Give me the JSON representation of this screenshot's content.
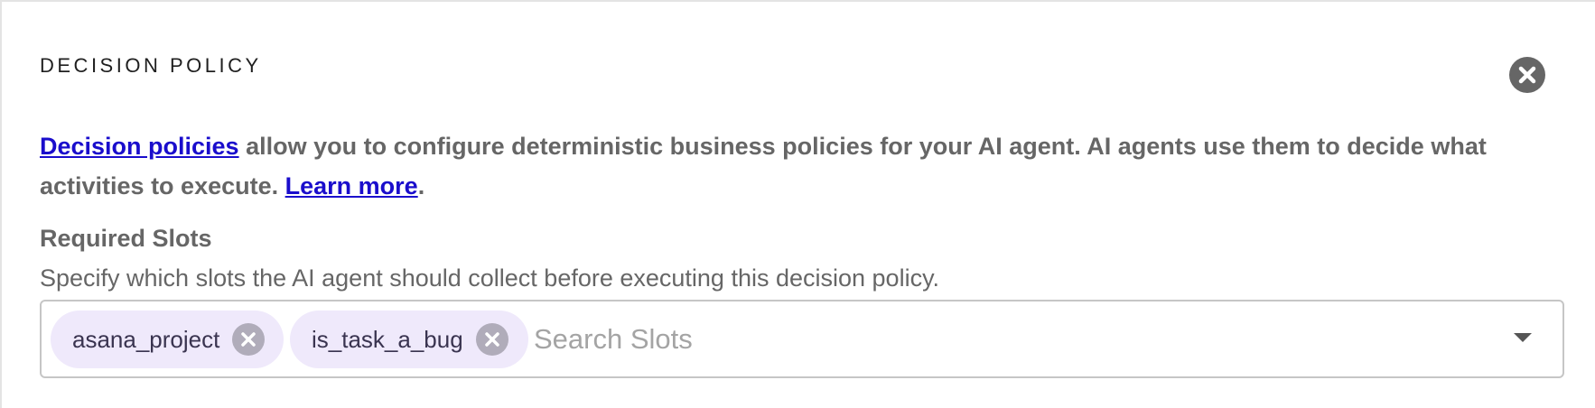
{
  "panel": {
    "title": "DECISION POLICY",
    "close_icon": "close-circle-icon"
  },
  "description": {
    "link1_text": "Decision policies",
    "text1": " allow you to configure deterministic business policies for your AI agent. AI agents use them to decide what activities to execute. ",
    "link2_text": "Learn more",
    "text2": "."
  },
  "required_slots": {
    "label": "Required Slots",
    "help": "Specify which slots the AI agent should collect before executing this decision policy.",
    "chips": [
      {
        "label": "asana_project",
        "remove_icon": "remove-circle-icon"
      },
      {
        "label": "is_task_a_bug",
        "remove_icon": "remove-circle-icon"
      }
    ],
    "search_placeholder": "Search Slots",
    "search_value": "",
    "dropdown_icon": "caret-down-icon"
  },
  "colors": {
    "link": "#1a0dcc",
    "chip_bg": "#efe9fb",
    "chip_text": "#3a3450",
    "text_muted": "#666666"
  }
}
